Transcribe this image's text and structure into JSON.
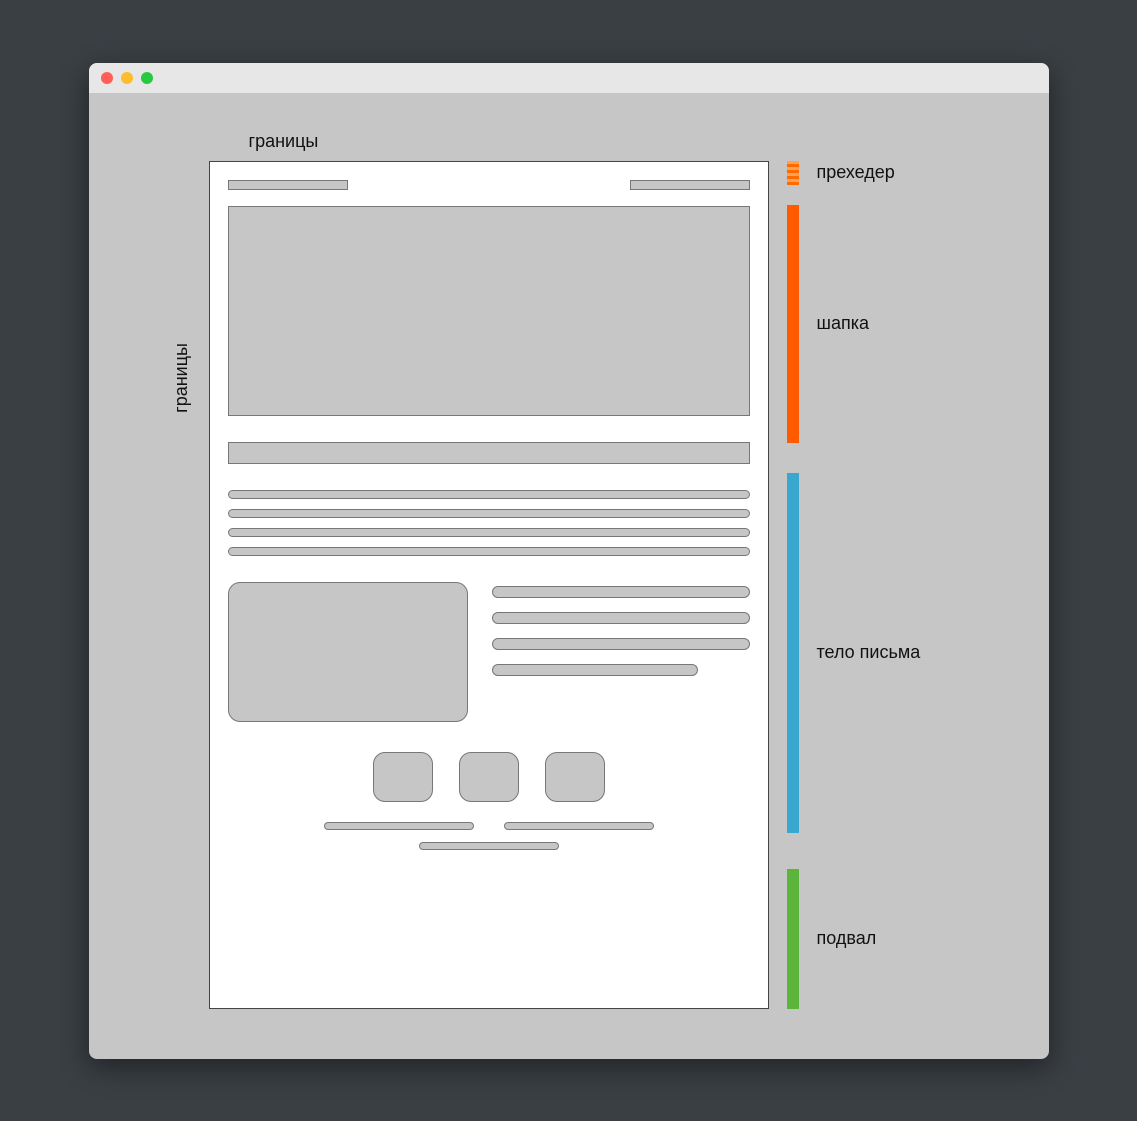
{
  "labels": {
    "boundary_top": "границы",
    "boundary_left": "границы"
  },
  "legend": {
    "preheader": "прехедер",
    "header": "шапка",
    "body": "тело письма",
    "footer": "подвал"
  }
}
